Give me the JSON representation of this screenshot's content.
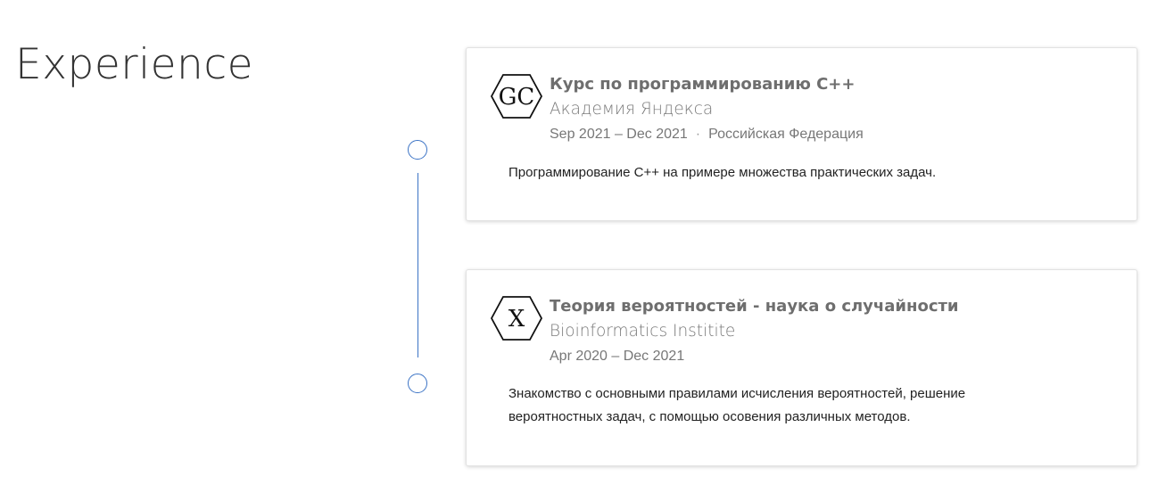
{
  "section": {
    "title": "Experience"
  },
  "accent_color": "#3b73c5",
  "entries": [
    {
      "icon": {
        "name": "hexagon-logo-icon",
        "text": "GC"
      },
      "title": "Курс по программированию С++",
      "organization": "Академия Яндекса",
      "dates": "Sep 2021 – Dec 2021",
      "separator": "·",
      "location": "Российская Федерация",
      "description": "Программирование С++ на примере множества практических задач."
    },
    {
      "icon": {
        "name": "hexagon-logo-icon",
        "text": "X"
      },
      "title": "Теория вероятностей - наука о случайности",
      "organization": "Bioinformatics Institite",
      "dates": "Apr 2020 – Dec 2021",
      "description": "Знакомство с основными правилами исчисления вероятностей, решение вероятностных задач, с помощью осовения различных методов."
    }
  ]
}
